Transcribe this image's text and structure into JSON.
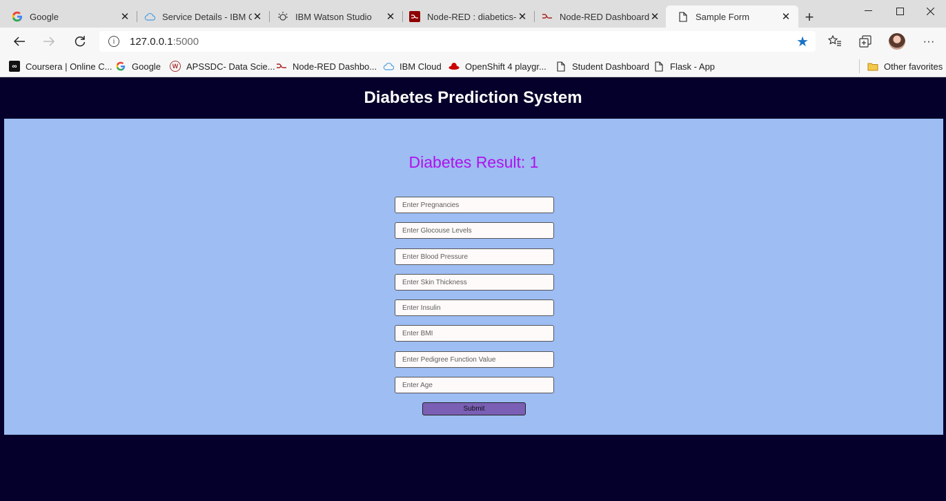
{
  "browser": {
    "tabs": [
      {
        "title": "Google",
        "icon": "google-icon",
        "active": false
      },
      {
        "title": "Service Details - IBM Clo",
        "icon": "cloud-icon",
        "active": false
      },
      {
        "title": "IBM Watson Studio",
        "icon": "watson-icon",
        "active": false
      },
      {
        "title": "Node-RED : diabetics-p",
        "icon": "node-red-icon",
        "active": false
      },
      {
        "title": "Node-RED Dashboard",
        "icon": "node-red-icon",
        "active": false
      },
      {
        "title": "Sample Form",
        "icon": "page-icon",
        "active": true
      }
    ],
    "address": {
      "host": "127.0.0.1",
      "port": ":5000"
    },
    "bookmarks": [
      {
        "label": "Coursera | Online C...",
        "icon": "coursera-icon"
      },
      {
        "label": "Google",
        "icon": "google-icon"
      },
      {
        "label": "APSSDC- Data Scie...",
        "icon": "apssdc-icon"
      },
      {
        "label": "Node-RED Dashbo...",
        "icon": "node-red-icon"
      },
      {
        "label": "IBM Cloud",
        "icon": "cloud-icon"
      },
      {
        "label": "OpenShift 4 playgr...",
        "icon": "redhat-icon"
      },
      {
        "label": "Student Dashboard",
        "icon": "page-icon"
      },
      {
        "label": "Flask - App",
        "icon": "page-icon"
      }
    ],
    "other_favorites": "Other favorites",
    "accent_color": "#1a73c7"
  },
  "page": {
    "title": "Diabetes Prediction System",
    "result_label": "Diabetes Result: 1",
    "result_color": "#b011ec",
    "background": "#05002b",
    "panel_color": "#9dbdf3",
    "fields": [
      {
        "placeholder": "Enter Pregnancies"
      },
      {
        "placeholder": "Enter Glocouse Levels"
      },
      {
        "placeholder": "Enter Blood Pressure"
      },
      {
        "placeholder": "Enter Skin Thickness"
      },
      {
        "placeholder": "Enter Insulin"
      },
      {
        "placeholder": "Enter BMI"
      },
      {
        "placeholder": "Enter Pedigree Function Value"
      },
      {
        "placeholder": "Enter Age"
      }
    ],
    "submit_label": "Submit"
  }
}
